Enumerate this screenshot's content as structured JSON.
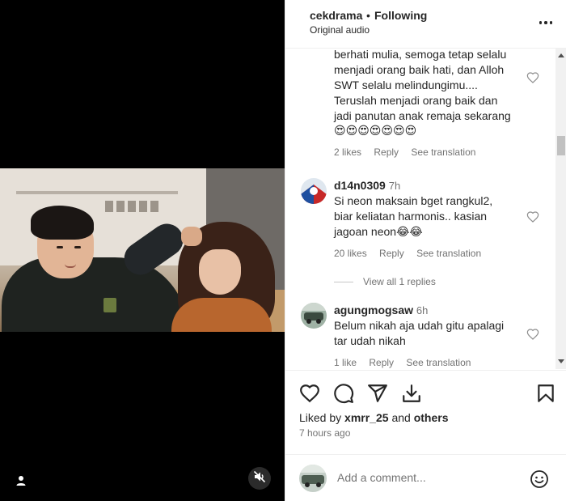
{
  "post": {
    "username": "cekdrama",
    "separator": "•",
    "follow_status": "Following",
    "audio": "Original audio"
  },
  "comments": [
    {
      "text_lines": [
        "berhati mulia, semoga tetap selalu",
        "menjadi orang baik hati, dan Alloh",
        "SWT selalu melindungimu....",
        "Teruslah menjadi orang baik dan",
        "jadi panutan anak remaja sekarang"
      ],
      "emojis": "😍😍😍😍😍😍😍",
      "likes": "2 likes",
      "reply": "Reply",
      "translate": "See translation"
    },
    {
      "username": "d14n0309",
      "time": "7h",
      "text_lines": [
        "Si neon maksain bget rangkul2,",
        "biar keliatan harmonis.. kasian",
        "jagoan neon"
      ],
      "emojis": "😂😂",
      "likes": "20 likes",
      "reply": "Reply",
      "translate": "See translation",
      "view_replies": "View all 1 replies"
    },
    {
      "username": "agungmogsaw",
      "time": "6h",
      "text_lines": [
        "Belum nikah aja udah gitu apalagi",
        "tar udah nikah"
      ],
      "likes": "1 like",
      "reply": "Reply",
      "translate": "See translation"
    }
  ],
  "footer": {
    "liked_by_prefix": "Liked by",
    "liked_by_user": "xmrr_25",
    "liked_by_and": "and",
    "liked_by_others": "others",
    "posted_time": "7 hours ago",
    "add_comment_placeholder": "Add a comment..."
  },
  "icons": {
    "like": "heart-icon",
    "comment": "comment-icon",
    "share": "send-icon",
    "download": "download-icon",
    "save": "bookmark-icon",
    "emoji": "emoji-icon",
    "mute": "muted-speaker-icon",
    "tagged": "person-icon",
    "more": "more-dots-icon"
  },
  "colors": {
    "text": "#262626",
    "secondary_text": "#737373",
    "divider": "#efefef",
    "media_bg": "#000000"
  }
}
